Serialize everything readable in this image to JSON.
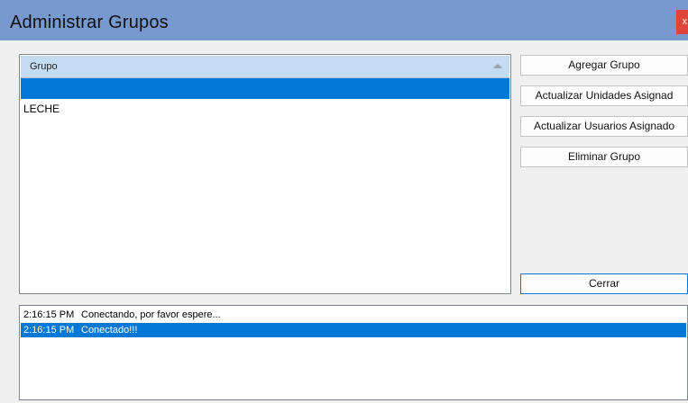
{
  "window": {
    "title": "Administrar Grupos",
    "close_label": "x",
    "accent_color": "#7899cf",
    "close_color": "#e0433a"
  },
  "groups_grid": {
    "column_header": "Grupo",
    "rows": [
      "",
      "LECHE"
    ],
    "selected_index": 0
  },
  "buttons": {
    "add_group": "Agregar Grupo",
    "update_units": "Actualizar Unidades Asignad",
    "update_users": "Actualizar Usuarios Asignado",
    "delete_group": "Eliminar Grupo",
    "close": "Cerrar"
  },
  "log": {
    "entries": [
      {
        "time": "2:16:15 PM",
        "message": "Conectando, por favor espere..."
      },
      {
        "time": "2:16:15 PM",
        "message": "Conectado!!!"
      }
    ],
    "selected_index": 1
  }
}
